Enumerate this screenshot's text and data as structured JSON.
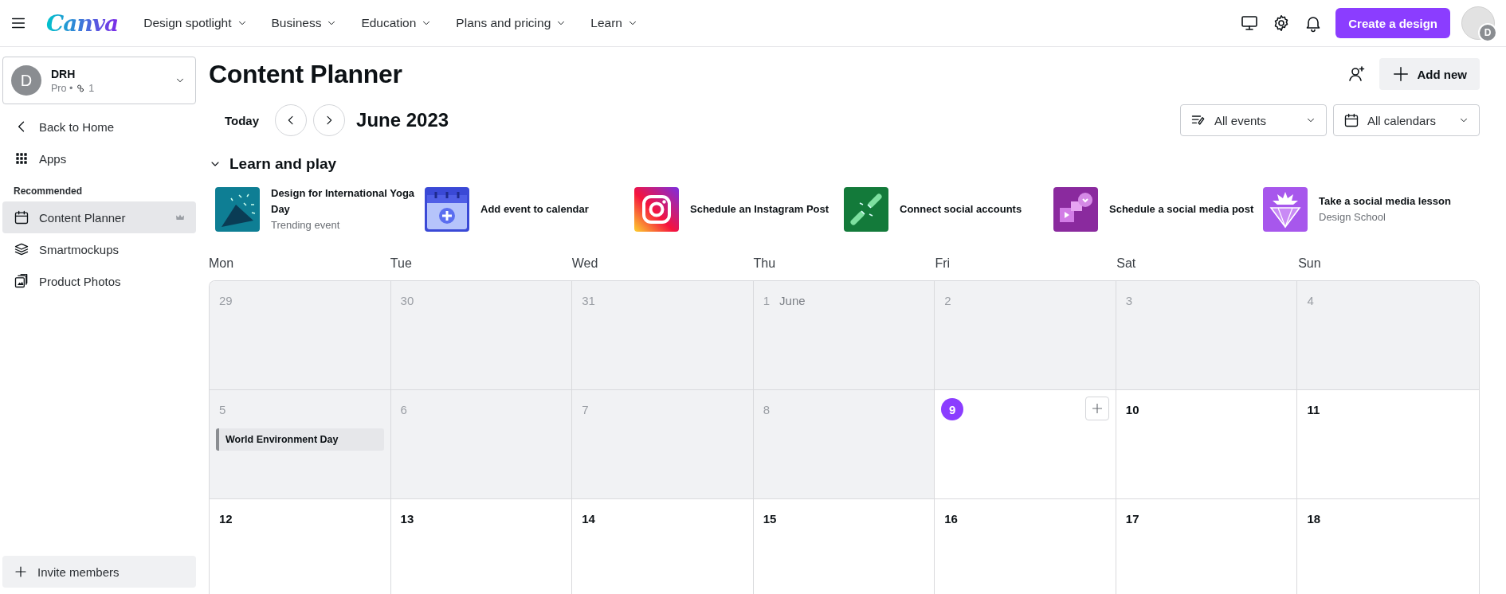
{
  "topbar": {
    "logo": "Canva",
    "menu_items": [
      {
        "label": "Design spotlight"
      },
      {
        "label": "Business"
      },
      {
        "label": "Education"
      },
      {
        "label": "Plans and pricing"
      },
      {
        "label": "Learn"
      }
    ],
    "create_button": "Create a design",
    "avatar_badge": "D"
  },
  "sidebar": {
    "team": {
      "initial": "D",
      "name": "DRH",
      "plan": "Pro •",
      "members": "1"
    },
    "nav": [
      {
        "label": "Back to Home",
        "kind": "back"
      },
      {
        "label": "Apps",
        "kind": "apps"
      }
    ],
    "section_title": "Recommended",
    "items": [
      {
        "label": "Content Planner",
        "selected": true,
        "premium": true
      },
      {
        "label": "Smartmockups",
        "selected": false,
        "premium": false
      },
      {
        "label": "Product Photos",
        "selected": false,
        "premium": false
      }
    ],
    "invite_button": "Invite members"
  },
  "main": {
    "title": "Content Planner",
    "add_new_button": "Add new",
    "today_button": "Today",
    "month": "June 2023",
    "filters": [
      {
        "label": "All events",
        "kind": "events"
      },
      {
        "label": "All calendars",
        "kind": "calendars"
      }
    ],
    "learn": {
      "title": "Learn and play",
      "expanded": true,
      "items": [
        {
          "title": "Design for International Yoga Day",
          "subtitle": "Trending event"
        },
        {
          "title": "Add event to calendar"
        },
        {
          "title": "Schedule an Instagram Post"
        },
        {
          "title": "Connect social accounts"
        },
        {
          "title": "Schedule a social media post"
        },
        {
          "title": "Take a social media lesson",
          "subtitle": "Design School"
        }
      ]
    },
    "calendar": {
      "weekdays": [
        "Mon",
        "Tue",
        "Wed",
        "Thu",
        "Fri",
        "Sat",
        "Sun"
      ],
      "weeks": [
        [
          {
            "day": "29",
            "past": true,
            "today": false
          },
          {
            "day": "30",
            "past": true,
            "today": false
          },
          {
            "day": "31",
            "past": true,
            "today": false
          },
          {
            "day": "1",
            "month_label": "June",
            "past": true,
            "today": false
          },
          {
            "day": "2",
            "past": true,
            "today": false
          },
          {
            "day": "3",
            "past": true,
            "today": false
          },
          {
            "day": "4",
            "past": true,
            "today": false
          }
        ],
        [
          {
            "day": "5",
            "past": true,
            "today": false,
            "events": [
              "World Environment Day"
            ]
          },
          {
            "day": "6",
            "past": true,
            "today": false
          },
          {
            "day": "7",
            "past": true,
            "today": false
          },
          {
            "day": "8",
            "past": true,
            "today": false
          },
          {
            "day": "9",
            "past": false,
            "today": true
          },
          {
            "day": "10",
            "past": false,
            "today": false
          },
          {
            "day": "11",
            "past": false,
            "today": false
          }
        ],
        [
          {
            "day": "12",
            "past": false,
            "today": false
          },
          {
            "day": "13",
            "past": false,
            "today": false
          },
          {
            "day": "14",
            "past": false,
            "today": false
          },
          {
            "day": "15",
            "past": false,
            "today": false
          },
          {
            "day": "16",
            "past": false,
            "today": false
          },
          {
            "day": "17",
            "past": false,
            "today": false
          },
          {
            "day": "18",
            "past": false,
            "today": false
          }
        ]
      ]
    }
  }
}
